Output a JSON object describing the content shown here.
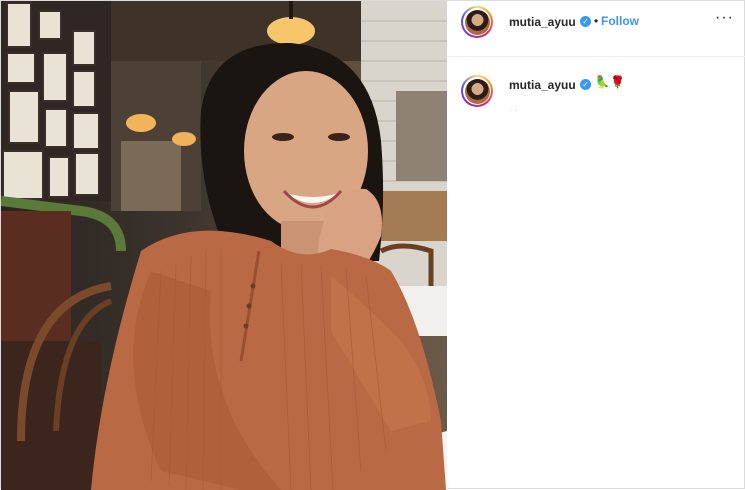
{
  "post": {
    "username": "mutia_ayuu",
    "follow_label": "Follow",
    "separator": "•",
    "more_label": "···",
    "caption_emojis": [
      "🦜",
      "🌹"
    ],
    "caption_meta": "·  ·"
  },
  "icons": {
    "verified": "verified-badge",
    "more": "ellipsis-icon"
  },
  "colors": {
    "link": "#3897f0",
    "text": "#262626",
    "border": "#dbdbdb",
    "verified": "#3897f0"
  }
}
